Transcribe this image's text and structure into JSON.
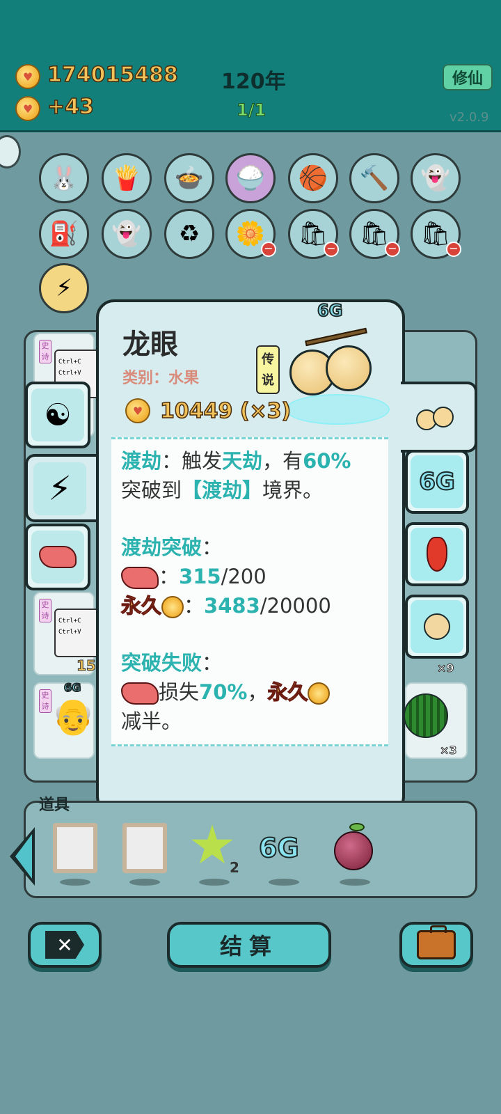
{
  "header": {
    "coins": "174015488",
    "coin_rate": "+43",
    "years": "120年",
    "progress": "1/1",
    "cultivate_button": "修仙",
    "version": "v2.0.9"
  },
  "inventory_slots": [
    {
      "icon": "rabbit-icon",
      "glyph": "🐰"
    },
    {
      "icon": "fries-icon",
      "glyph": "🍟"
    },
    {
      "icon": "pot-duck-icon",
      "glyph": "🍲"
    },
    {
      "icon": "rice-bowl-icon",
      "glyph": "🍚"
    },
    {
      "icon": "basketballs-icon",
      "glyph": "🏀"
    },
    {
      "icon": "hammer-icon",
      "glyph": "🔨"
    },
    {
      "icon": "ghost-icon",
      "glyph": "👻"
    },
    {
      "icon": "pump-icon",
      "glyph": "⛽"
    },
    {
      "icon": "ghost-tongue-icon",
      "glyph": "👻"
    },
    {
      "icon": "recycle-icon",
      "glyph": "♻"
    },
    {
      "icon": "potted-flower-icon",
      "glyph": "🌼"
    },
    {
      "icon": "sack-icon",
      "glyph": "🛍"
    },
    {
      "icon": "sack-icon",
      "glyph": "🛍"
    },
    {
      "icon": "sack-icon",
      "glyph": "🛍"
    },
    {
      "icon": "lightning-icon",
      "glyph": "⚡"
    }
  ],
  "background_cards": {
    "poem_tag": "史诗",
    "ctrl_c": "Ctrl+C",
    "ctrl_v": "Ctrl+V",
    "count_15": "15",
    "g6_label": "6G",
    "qty_x9": "×9",
    "qty_x3": "×3"
  },
  "detail": {
    "name": "龙眼",
    "category": "类别：水果",
    "rarity": "传说",
    "price": "10449 (×3)",
    "tier_tag": "6G",
    "desc": {
      "l1_a": "渡劫",
      "l1_b": "：触发",
      "l1_c": "天劫",
      "l1_d": "，有",
      "l1_e": "60%",
      "l2_a": "突破到",
      "l2_b": "【渡劫】",
      "l2_c": "境界。",
      "s2_title": "渡劫突破",
      "s2_colon": "：",
      "liver_colon": "：",
      "liver_cur": "315",
      "liver_max": "/200",
      "perm_label": "永久",
      "perm_colon": "：",
      "perm_cur": "3483",
      "perm_max": "/20000",
      "s3_title": "突破失败",
      "s3_colon": "：",
      "loss_a": "损失",
      "loss_pct": "70%",
      "loss_b": "，",
      "loss_perm": "永久",
      "loss_end": "减半。"
    }
  },
  "side_tabs": {
    "left": [
      "yin-yang-icon",
      "lightning-icon",
      "liver-icon"
    ],
    "right": [
      "longan-icon",
      "6G",
      "chili-icon",
      "pear-icon"
    ]
  },
  "props": {
    "label": "道具",
    "star_count": "2",
    "g6": "6G"
  },
  "buttons": {
    "settle": "结算"
  },
  "colors": {
    "topbar": "#137f7b",
    "accent_teal": "#2cb3b0",
    "gold": "#f2c25a",
    "panel": "#d7ecee"
  }
}
